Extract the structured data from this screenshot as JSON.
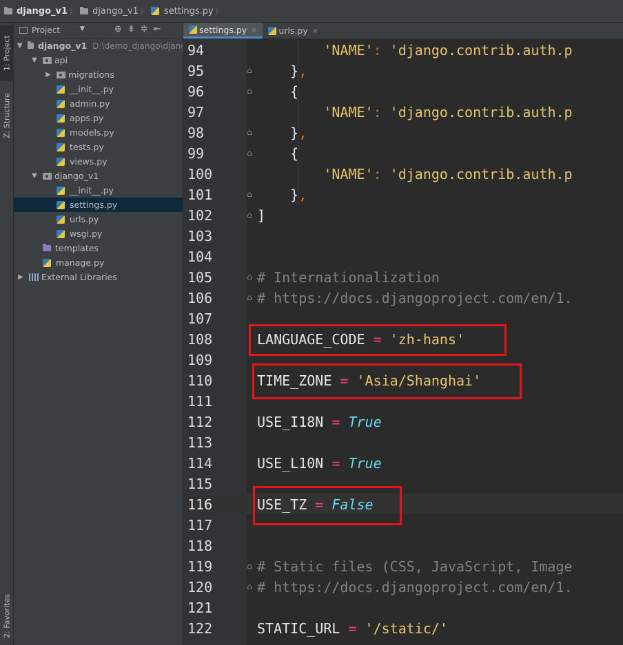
{
  "breadcrumb": {
    "project": "django_v1",
    "folder": "django_v1",
    "file": "settings.py"
  },
  "left_stripe": {
    "project_tab": "1: Project",
    "structure_tab": "Z: Structure",
    "favorites_tab": "2: Favorites"
  },
  "project_panel": {
    "title": "Project",
    "tree": [
      {
        "label": "django_v1",
        "path": "D:\\demo_django\\djang",
        "icon": "folder-icon",
        "depth": 0,
        "expanded": true
      },
      {
        "label": "api",
        "icon": "package-icon",
        "depth": 1,
        "expanded": true
      },
      {
        "label": "migrations",
        "icon": "package-icon",
        "depth": 2,
        "expanded": false
      },
      {
        "label": "__init__.py",
        "icon": "python-file-icon",
        "depth": 2
      },
      {
        "label": "admin.py",
        "icon": "python-file-icon",
        "depth": 2
      },
      {
        "label": "apps.py",
        "icon": "python-file-icon",
        "depth": 2
      },
      {
        "label": "models.py",
        "icon": "python-file-icon",
        "depth": 2
      },
      {
        "label": "tests.py",
        "icon": "python-file-icon",
        "depth": 2
      },
      {
        "label": "views.py",
        "icon": "python-file-icon",
        "depth": 2
      },
      {
        "label": "django_v1",
        "icon": "package-icon",
        "depth": 1,
        "expanded": true
      },
      {
        "label": "__init__.py",
        "icon": "python-file-icon",
        "depth": 2
      },
      {
        "label": "settings.py",
        "icon": "python-file-icon",
        "depth": 2,
        "selected": true
      },
      {
        "label": "urls.py",
        "icon": "python-file-icon",
        "depth": 2
      },
      {
        "label": "wsgi.py",
        "icon": "python-file-icon",
        "depth": 2
      },
      {
        "label": "templates",
        "icon": "templates-folder-icon",
        "depth": 1
      },
      {
        "label": "manage.py",
        "icon": "python-file-icon",
        "depth": 1
      },
      {
        "label": "External Libraries",
        "icon": "library-icon",
        "depth": 0,
        "expanded": false
      }
    ]
  },
  "tabs": [
    {
      "label": "settings.py",
      "active": true,
      "close": "×"
    },
    {
      "label": "urls.py",
      "active": false,
      "close": "×"
    }
  ],
  "editor": {
    "current_line": "116",
    "lines": [
      {
        "num": "94",
        "indent": "        ",
        "parts": [
          {
            "t": "'NAME'",
            "c": "str"
          },
          {
            "t": ": ",
            "c": "op"
          },
          {
            "t": "'django.contrib.auth.p",
            "c": "str"
          }
        ]
      },
      {
        "num": "95",
        "indent": "    ",
        "parts": [
          {
            "t": "}",
            "c": "var"
          },
          {
            "t": ",",
            "c": "op"
          }
        ]
      },
      {
        "num": "96",
        "indent": "    ",
        "parts": [
          {
            "t": "{",
            "c": "var"
          }
        ]
      },
      {
        "num": "97",
        "indent": "        ",
        "parts": [
          {
            "t": "'NAME'",
            "c": "str"
          },
          {
            "t": ": ",
            "c": "op"
          },
          {
            "t": "'django.contrib.auth.p",
            "c": "str"
          }
        ]
      },
      {
        "num": "98",
        "indent": "    ",
        "parts": [
          {
            "t": "}",
            "c": "var"
          },
          {
            "t": ",",
            "c": "op"
          }
        ]
      },
      {
        "num": "99",
        "indent": "    ",
        "parts": [
          {
            "t": "{",
            "c": "var"
          }
        ]
      },
      {
        "num": "100",
        "indent": "        ",
        "parts": [
          {
            "t": "'NAME'",
            "c": "str"
          },
          {
            "t": ": ",
            "c": "op"
          },
          {
            "t": "'django.contrib.auth.p",
            "c": "str"
          }
        ]
      },
      {
        "num": "101",
        "indent": "    ",
        "parts": [
          {
            "t": "}",
            "c": "var"
          },
          {
            "t": ",",
            "c": "op"
          }
        ]
      },
      {
        "num": "102",
        "indent": "",
        "parts": [
          {
            "t": "]",
            "c": "var"
          }
        ]
      },
      {
        "num": "103",
        "indent": "",
        "parts": []
      },
      {
        "num": "104",
        "indent": "",
        "parts": []
      },
      {
        "num": "105",
        "indent": "",
        "parts": [
          {
            "t": "# Internationalization",
            "c": "com"
          }
        ]
      },
      {
        "num": "106",
        "indent": "",
        "parts": [
          {
            "t": "# https://docs.djangoproject.com/en/1.",
            "c": "com"
          }
        ]
      },
      {
        "num": "107",
        "indent": "",
        "parts": []
      },
      {
        "num": "108",
        "indent": "",
        "parts": [
          {
            "t": "LANGUAGE_CODE",
            "c": "var"
          },
          {
            "t": " = ",
            "c": "eq"
          },
          {
            "t": "'zh-hans'",
            "c": "str"
          }
        ]
      },
      {
        "num": "109",
        "indent": "",
        "parts": []
      },
      {
        "num": "110",
        "indent": "",
        "parts": [
          {
            "t": "TIME_ZONE",
            "c": "var"
          },
          {
            "t": " = ",
            "c": "eq"
          },
          {
            "t": "'Asia/Shanghai'",
            "c": "str"
          }
        ]
      },
      {
        "num": "111",
        "indent": "",
        "parts": []
      },
      {
        "num": "112",
        "indent": "",
        "parts": [
          {
            "t": "USE_I18N",
            "c": "var"
          },
          {
            "t": " = ",
            "c": "eq"
          },
          {
            "t": "True",
            "c": "kw"
          }
        ]
      },
      {
        "num": "113",
        "indent": "",
        "parts": []
      },
      {
        "num": "114",
        "indent": "",
        "parts": [
          {
            "t": "USE_L10N",
            "c": "var"
          },
          {
            "t": " = ",
            "c": "eq"
          },
          {
            "t": "True",
            "c": "kw"
          }
        ]
      },
      {
        "num": "115",
        "indent": "",
        "parts": []
      },
      {
        "num": "116",
        "indent": "",
        "parts": [
          {
            "t": "USE_TZ",
            "c": "var"
          },
          {
            "t": " = ",
            "c": "eq"
          },
          {
            "t": "False",
            "c": "kw"
          }
        ]
      },
      {
        "num": "117",
        "indent": "",
        "parts": []
      },
      {
        "num": "118",
        "indent": "",
        "parts": []
      },
      {
        "num": "119",
        "indent": "",
        "parts": [
          {
            "t": "# Static files (CSS, JavaScript, Image",
            "c": "com"
          }
        ]
      },
      {
        "num": "120",
        "indent": "",
        "parts": [
          {
            "t": "# https://docs.djangoproject.com/en/1.",
            "c": "com"
          }
        ]
      },
      {
        "num": "121",
        "indent": "",
        "parts": []
      },
      {
        "num": "122",
        "indent": "",
        "parts": [
          {
            "t": "STATIC_URL",
            "c": "var"
          },
          {
            "t": " = ",
            "c": "eq"
          },
          {
            "t": "'/static/'",
            "c": "str"
          }
        ]
      }
    ],
    "fold_markers": [
      "95",
      "96",
      "98",
      "99",
      "101",
      "102",
      "105",
      "106",
      "119",
      "120"
    ],
    "highlighted_lines": [
      "108",
      "110",
      "116"
    ]
  },
  "colors": {
    "highlight_box": "#e5141b",
    "selection": "#0d293e",
    "tab_underline": "#4a88c7"
  }
}
